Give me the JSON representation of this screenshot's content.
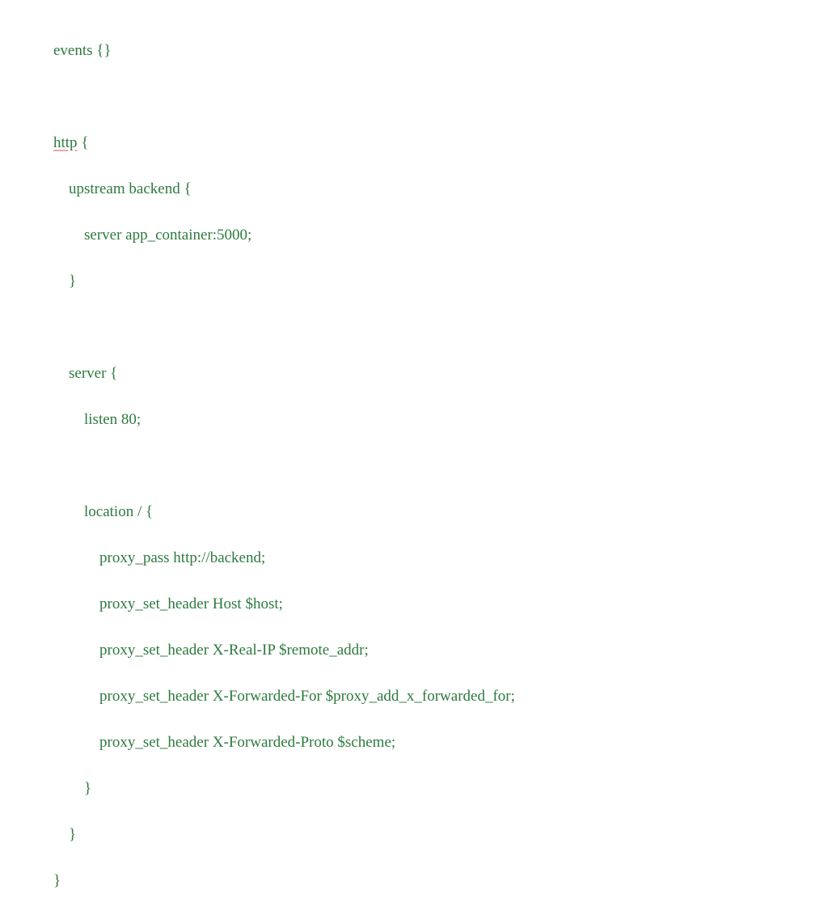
{
  "code": {
    "text_color": "#2d7a3e",
    "underline_color": "#f4a6a6",
    "lines": [
      "events {}",
      "",
      "http {",
      "    upstream backend {",
      "        server app_container:5000;",
      "    }",
      "",
      "    server {",
      "        listen 80;",
      "",
      "        location / {",
      "            proxy_pass http://backend;",
      "            proxy_set_header Host $host;",
      "            proxy_set_header X-Real-IP $remote_addr;",
      "            proxy_set_header X-Forwarded-For $proxy_add_x_forwarded_for;",
      "            proxy_set_header X-Forwarded-Proto $scheme;",
      "        }",
      "    }",
      "}"
    ],
    "underlined_word": "http",
    "underlined_line_index": 2
  }
}
